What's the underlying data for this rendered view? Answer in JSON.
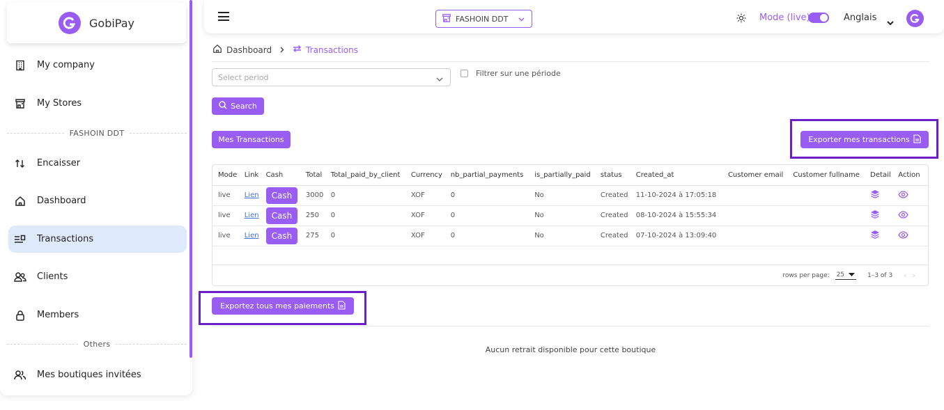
{
  "app": {
    "name": "GobiPay"
  },
  "sidebar": {
    "items_top": [
      {
        "label": "My company",
        "icon": "building-icon"
      },
      {
        "label": "My Stores",
        "icon": "store-icon"
      }
    ],
    "section_store": "FASHOIN DDT",
    "items_store": [
      {
        "label": "Encaisser",
        "icon": "arrows-updown-icon"
      },
      {
        "label": "Dashboard",
        "icon": "home-icon"
      },
      {
        "label": "Transactions",
        "icon": "list-icon",
        "active": true
      },
      {
        "label": "Clients",
        "icon": "users-icon"
      },
      {
        "label": "Members",
        "icon": "lock-icon"
      }
    ],
    "section_others": "Others",
    "items_others": [
      {
        "label": "Mes boutiques invitées",
        "icon": "group-icon"
      }
    ]
  },
  "topbar": {
    "store": "FASHOIN DDT",
    "mode_label": "Mode (live)",
    "language": "Anglais"
  },
  "breadcrumb": {
    "home": "Dashboard",
    "current": "Transactions"
  },
  "filters": {
    "period_placeholder": "Select period",
    "filter_label": "Filtrer sur une période",
    "search_label": "Search"
  },
  "buttons": {
    "mes_transactions": "Mes Transactions",
    "export": "Exporter mes transactions",
    "export_all": "Exportez tous mes paiements"
  },
  "table": {
    "headers": [
      "Mode",
      "Link",
      "Cash",
      "Total",
      "Total_paid_by_client",
      "Currency",
      "nb_partial_payments",
      "is_partially_paid",
      "status",
      "Created_at",
      "Customer email",
      "Customer fullname",
      "Detail",
      "Action"
    ],
    "rows": [
      {
        "mode": "live",
        "link": "Lien",
        "cash": "Cash",
        "total": "3000",
        "paid": "0",
        "currency": "XOF",
        "nb_partial": "0",
        "is_partial": "No",
        "status": "Created",
        "created_at": "11-10-2024 à 17:05:18",
        "email": "",
        "fullname": ""
      },
      {
        "mode": "live",
        "link": "Lien",
        "cash": "Cash",
        "total": "250",
        "paid": "0",
        "currency": "XOF",
        "nb_partial": "0",
        "is_partial": "No",
        "status": "Created",
        "created_at": "08-10-2024 à 15:55:34",
        "email": "",
        "fullname": ""
      },
      {
        "mode": "live",
        "link": "Lien",
        "cash": "Cash",
        "total": "275",
        "paid": "0",
        "currency": "XOF",
        "nb_partial": "0",
        "is_partial": "No",
        "status": "Created",
        "created_at": "07-10-2024 à 13:09:40",
        "email": "",
        "fullname": ""
      }
    ],
    "rows_per_page_label": "rows per page:",
    "rows_per_page": "25",
    "range": "1–3 of 3"
  },
  "empty_message": "Aucun retrait disponible pour cette boutique",
  "colors": {
    "accent": "#9a5df3",
    "highlight": "#6a1fc8",
    "active_bg": "#dfe9fc"
  }
}
